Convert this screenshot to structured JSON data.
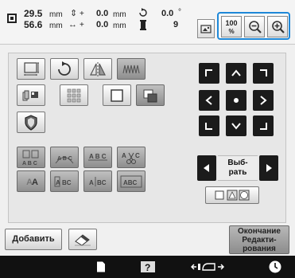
{
  "header": {
    "width_value": "29.5",
    "width_unit": "mm",
    "height_value": "56.6",
    "height_unit": "mm",
    "offset_v_sign": "+",
    "offset_v_value": "0.0",
    "offset_v_unit": "mm",
    "offset_h_sign": "+",
    "offset_h_value": "0.0",
    "offset_h_unit": "mm",
    "rotation_value": "0.0",
    "rotation_unit": "°",
    "thread_count": "9",
    "zoom_value": "100",
    "zoom_unit": "%"
  },
  "select": {
    "line1": "Выб-",
    "line2": "рать"
  },
  "buttons": {
    "text_icons": [
      "A B C",
      "A B C",
      "A B C",
      "A B C",
      "A B C",
      "ABC"
    ],
    "mirror_text": "A",
    "mirror_text2": "A"
  },
  "footer": {
    "add_label": "Добавить",
    "finish_line1": "Окончание",
    "finish_line2": "Редакти-",
    "finish_line3": "рования"
  },
  "colors": {
    "accent": "#1e88d8",
    "nav_dark": "#1b1b1b",
    "status_bar": "#111111"
  },
  "icons": {
    "size": "size-icon",
    "rotate": "rotate-icon",
    "mirror": "mirror-icon",
    "density": "density-icon",
    "zoom_out": "zoom-out-icon",
    "zoom_in": "zoom-in-icon",
    "camera": "camera-icon"
  }
}
